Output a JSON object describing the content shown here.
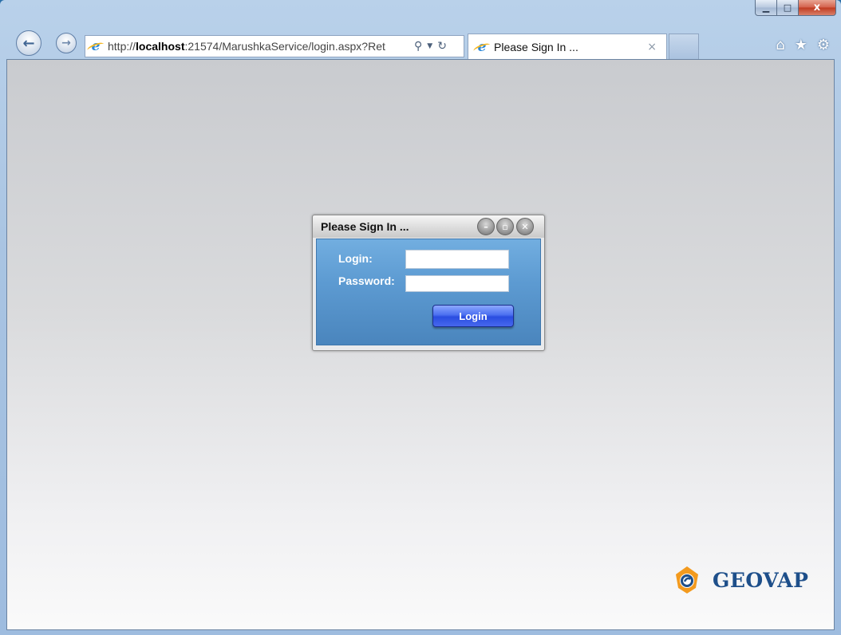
{
  "browser": {
    "address": {
      "url_prefix": "http://",
      "url_host": "localhost",
      "url_rest": ":21574/MarushkaService/login.aspx?Ret"
    },
    "tab": {
      "title": "Please Sign In ...",
      "close_glyph": "×"
    },
    "window_controls": {
      "minimize_glyph": "▁",
      "maximize_glyph": "□",
      "close_glyph": "x"
    },
    "icons": {
      "back": "arrow-left-icon",
      "forward": "arrow-right-icon",
      "search": "search-icon",
      "refresh": "refresh-icon",
      "home": "home-icon",
      "favorites": "star-icon",
      "tools": "gear-icon"
    }
  },
  "dialog": {
    "title": "Please Sign In ...",
    "login_label": "Login:",
    "password_label": "Password:",
    "login_value": "",
    "password_value": "",
    "button_label": "Login"
  },
  "logo": {
    "text": "GEOVAP"
  },
  "colors": {
    "dialog_body": "#5d9bd2",
    "login_button": "#3a5ee8",
    "logo_orange": "#f39a1e",
    "logo_blue": "#1e4f8a"
  }
}
